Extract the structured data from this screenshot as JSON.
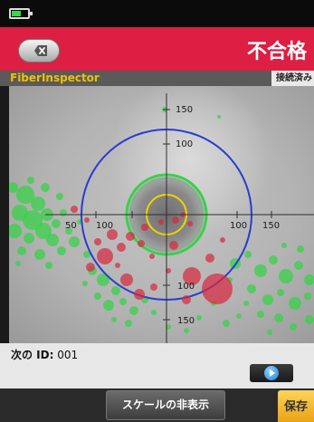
{
  "header": {
    "result": "不合格"
  },
  "infobar": {
    "app_name": "FiberInspector",
    "status": "接続済み"
  },
  "inspection": {
    "scale_labels": {
      "y_top_150": "150",
      "y_top_100": "100",
      "x_left_50": "50",
      "x_left_100": "100",
      "x_right_100": "100",
      "x_right_150": "150",
      "y_bottom_100": "100",
      "y_bottom_150": "150"
    },
    "colors": {
      "cladding_ring": "#2a3cd0",
      "contact_ring": "#38d14a",
      "core_ring": "#f1d000",
      "defect_fail": "#d9263d",
      "defect_pass": "#38d14a"
    }
  },
  "footer": {
    "next_id_label": "次の ID:",
    "next_id_value": "001"
  },
  "buttons": {
    "scale_toggle": "スケールの非表示",
    "save": "保存"
  },
  "icons": {
    "back": "back-x-icon",
    "play": "play-icon",
    "battery": "battery-icon"
  }
}
